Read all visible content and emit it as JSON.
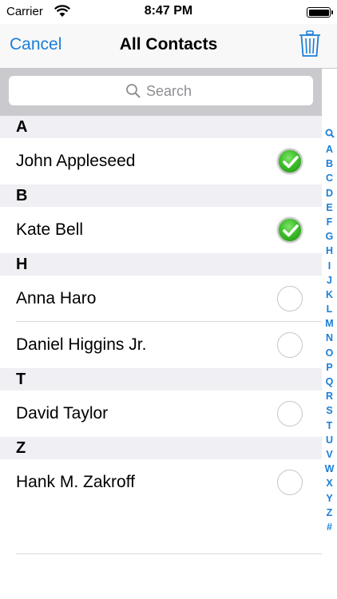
{
  "status_bar": {
    "carrier": "Carrier",
    "time": "8:47 PM"
  },
  "nav": {
    "cancel_label": "Cancel",
    "title": "All Contacts",
    "trash_icon": "trash-icon"
  },
  "search": {
    "placeholder": "Search"
  },
  "sections": [
    {
      "letter": "A",
      "contacts": [
        {
          "name": "John Appleseed",
          "selected": true
        }
      ]
    },
    {
      "letter": "B",
      "contacts": [
        {
          "name": "Kate Bell",
          "selected": true
        }
      ]
    },
    {
      "letter": "H",
      "contacts": [
        {
          "name": "Anna Haro",
          "selected": false
        },
        {
          "name": "Daniel Higgins Jr.",
          "selected": false
        }
      ]
    },
    {
      "letter": "T",
      "contacts": [
        {
          "name": "David Taylor",
          "selected": false
        }
      ]
    },
    {
      "letter": "Z",
      "contacts": [
        {
          "name": "Hank M. Zakroff",
          "selected": false
        }
      ]
    }
  ],
  "index": [
    "A",
    "B",
    "C",
    "D",
    "E",
    "F",
    "G",
    "H",
    "I",
    "J",
    "K",
    "L",
    "M",
    "N",
    "O",
    "P",
    "Q",
    "R",
    "S",
    "T",
    "U",
    "V",
    "W",
    "X",
    "Y",
    "Z",
    "#"
  ],
  "colors": {
    "accent": "#1a7ed8",
    "check_green": "#3fbf2a"
  }
}
